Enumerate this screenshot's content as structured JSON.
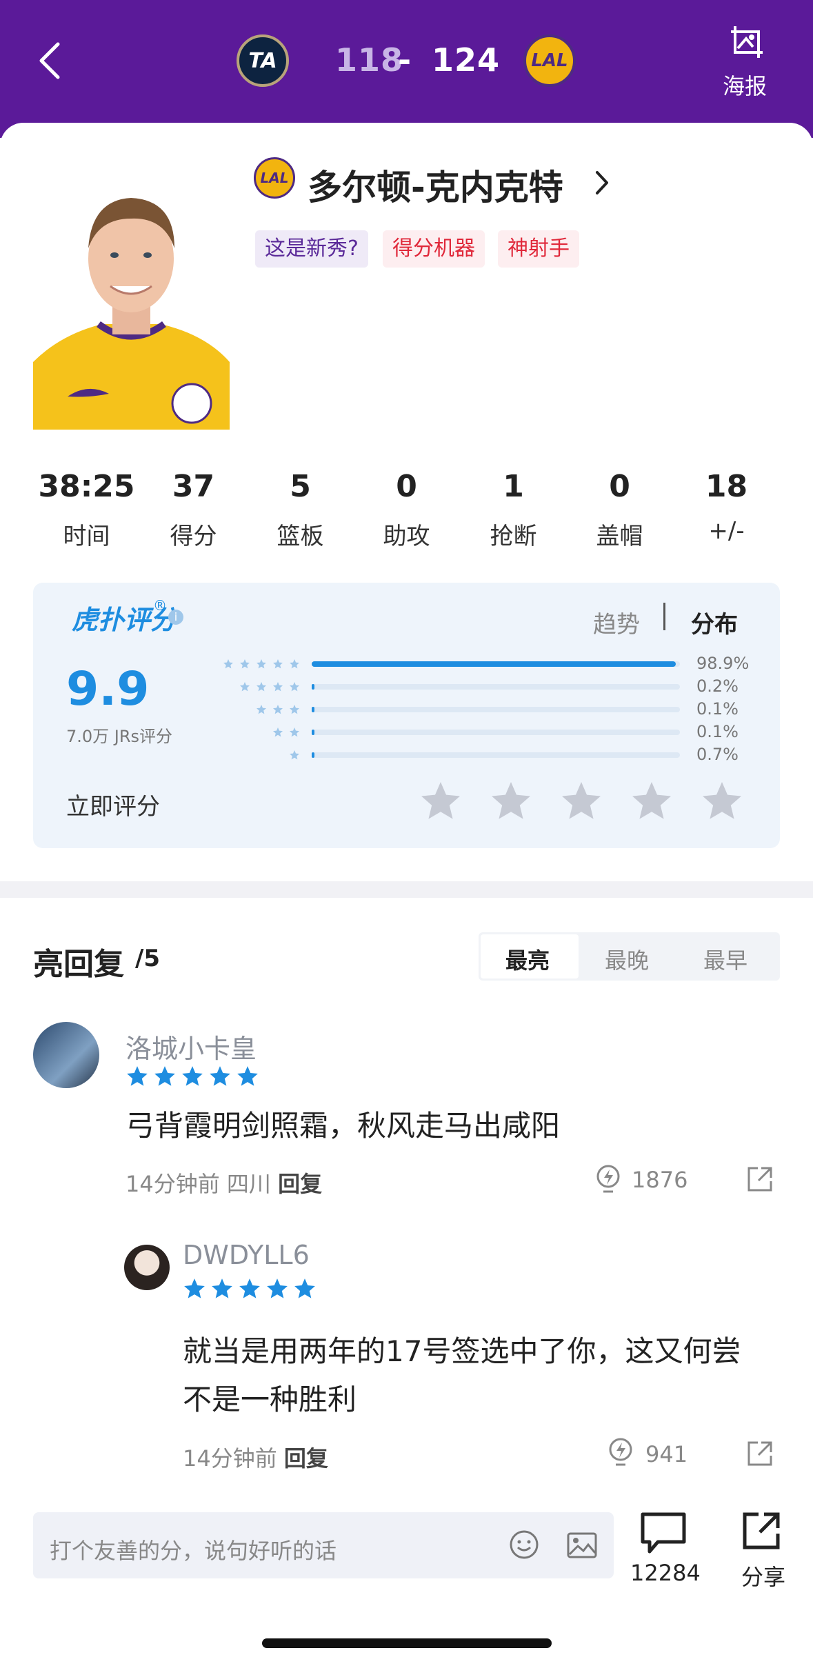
{
  "header": {
    "away_team_logo_text": "TA",
    "home_team_logo_text": "LAL",
    "away_score": "118",
    "separator": "-",
    "home_score": "124",
    "poster_label": "海报"
  },
  "player": {
    "team_logo_text": "LAL",
    "name": "多尔顿-克内克特",
    "tags": [
      "这是新秀?",
      "得分机器",
      "神射手"
    ]
  },
  "stats": [
    {
      "value": "38:25",
      "label": "时间"
    },
    {
      "value": "37",
      "label": "得分"
    },
    {
      "value": "5",
      "label": "篮板"
    },
    {
      "value": "0",
      "label": "助攻"
    },
    {
      "value": "1",
      "label": "抢断"
    },
    {
      "value": "0",
      "label": "盖帽"
    },
    {
      "value": "18",
      "label": "+/-"
    }
  ],
  "rating": {
    "brand": "虎扑评分",
    "registered": "®",
    "info": "i",
    "tab_trend": "趋势",
    "tab_distribution": "分布",
    "score": "9.9",
    "count_text": "7.0万 JRs评分",
    "rate_now": "立即评分",
    "distribution": [
      {
        "stars": 5,
        "pct": "98.9%",
        "value": 0.989
      },
      {
        "stars": 4,
        "pct": "0.2%",
        "value": 0.002
      },
      {
        "stars": 3,
        "pct": "0.1%",
        "value": 0.001
      },
      {
        "stars": 2,
        "pct": "0.1%",
        "value": 0.001
      },
      {
        "stars": 1,
        "pct": "0.7%",
        "value": 0.007
      }
    ],
    "colors": {
      "accent": "#1e8de0",
      "star_empty": "#c5c9d3"
    }
  },
  "comments_section": {
    "title": "亮回复",
    "count": "/5",
    "sort_tabs": [
      "最亮",
      "最晚",
      "最早"
    ],
    "comments": [
      {
        "user": "洛城小卡皇",
        "stars": 5,
        "text": "弓背霞明剑照霜，秋风走马出咸阳",
        "time": "14分钟前",
        "location": "四川",
        "reply": "回复",
        "likes": "1876"
      },
      {
        "user": "DWDYLL6",
        "stars": 5,
        "text": "就当是用两年的17号签选中了你，这又何尝不是一种胜利",
        "time": "14分钟前",
        "reply": "回复",
        "likes": "941"
      }
    ]
  },
  "bottom_bar": {
    "input_placeholder": "打个友善的分，说句好听的话",
    "comment_count": "12284",
    "share_label": "分享"
  },
  "colors": {
    "header_bg": "#5b1a99",
    "brand_purple": "#5b2a99",
    "tag_red": "#e0283a"
  }
}
